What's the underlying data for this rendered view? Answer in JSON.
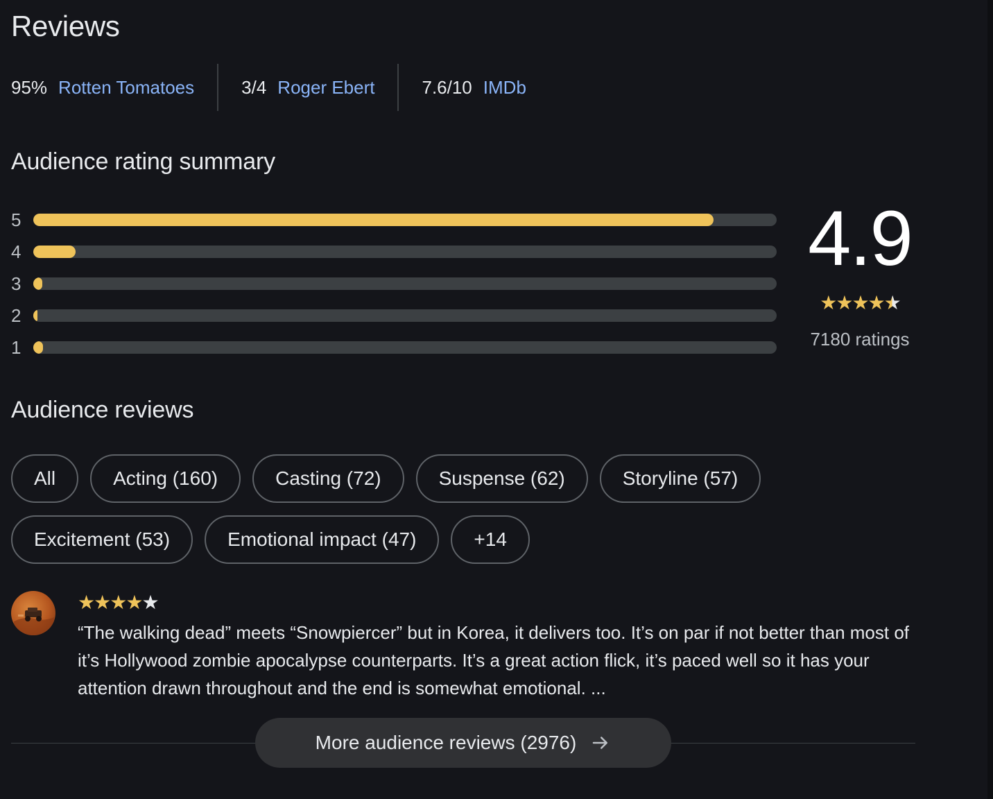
{
  "reviews": {
    "title": "Reviews",
    "critics": [
      {
        "score": "95%",
        "source": "Rotten Tomatoes"
      },
      {
        "score": "3/4",
        "source": "Roger Ebert"
      },
      {
        "score": "7.6/10",
        "source": "IMDb"
      }
    ]
  },
  "summary": {
    "heading": "Audience rating summary",
    "distribution": [
      {
        "label": "5",
        "fraction": 0.915
      },
      {
        "label": "4",
        "fraction": 0.057
      },
      {
        "label": "3",
        "fraction": 0.012
      },
      {
        "label": "2",
        "fraction": 0.005
      },
      {
        "label": "1",
        "fraction": 0.013
      }
    ],
    "average": "4.9",
    "average_stars": 4.5,
    "ratings_count": "7180 ratings"
  },
  "audience_reviews": {
    "heading": "Audience reviews",
    "chips": [
      {
        "label": "All"
      },
      {
        "label": "Acting (160)"
      },
      {
        "label": "Casting (72)"
      },
      {
        "label": "Suspense (62)"
      },
      {
        "label": "Storyline (57)"
      },
      {
        "label": "Excitement (53)"
      },
      {
        "label": "Emotional impact (47)"
      },
      {
        "label": "+14"
      }
    ],
    "review": {
      "stars": 4,
      "text": "“The walking dead” meets “Snowpiercer” but in Korea, it delivers too. It’s on par if not better than most of it’s Hollywood zombie apocalypse counterparts. It’s a great action flick, it’s paced well so it has your attention drawn throughout and the end is somewhat emotional. ..."
    },
    "more_button": "More audience reviews (2976)"
  },
  "colors": {
    "background": "#14151a",
    "accent_star": "#efc35a",
    "link": "#8ab4f8",
    "bar_track": "#3c4043"
  }
}
